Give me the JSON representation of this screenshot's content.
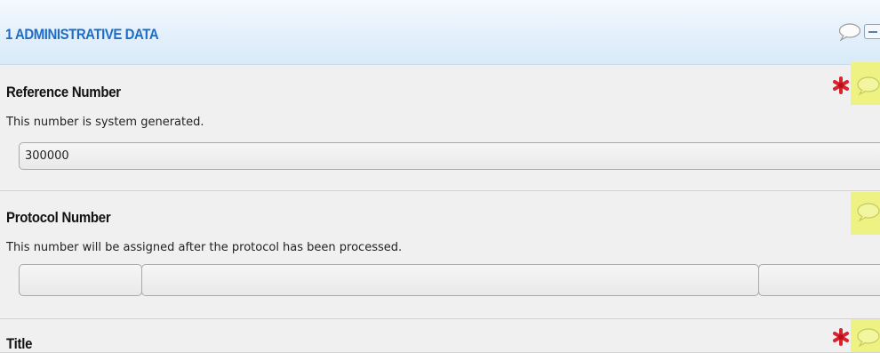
{
  "header": {
    "title": "1 ADMINISTRATIVE DATA",
    "comment_icon": "speech-bubble-icon",
    "collapse_icon": "collapse-minus-icon"
  },
  "fields": {
    "reference": {
      "label": "Reference Number",
      "help": "This number is system generated.",
      "value": "300000",
      "required": true
    },
    "protocol": {
      "label": "Protocol Number",
      "help": "This number will be assigned after the protocol has been processed.",
      "values": [
        "",
        "",
        ""
      ],
      "required": false
    },
    "title": {
      "label": "Title",
      "required": true
    }
  },
  "colors": {
    "header_text": "#1e6cc7",
    "required_icon": "#d9232f",
    "comment_highlight": "#eef283",
    "section_bg": "#f0f0f0"
  }
}
